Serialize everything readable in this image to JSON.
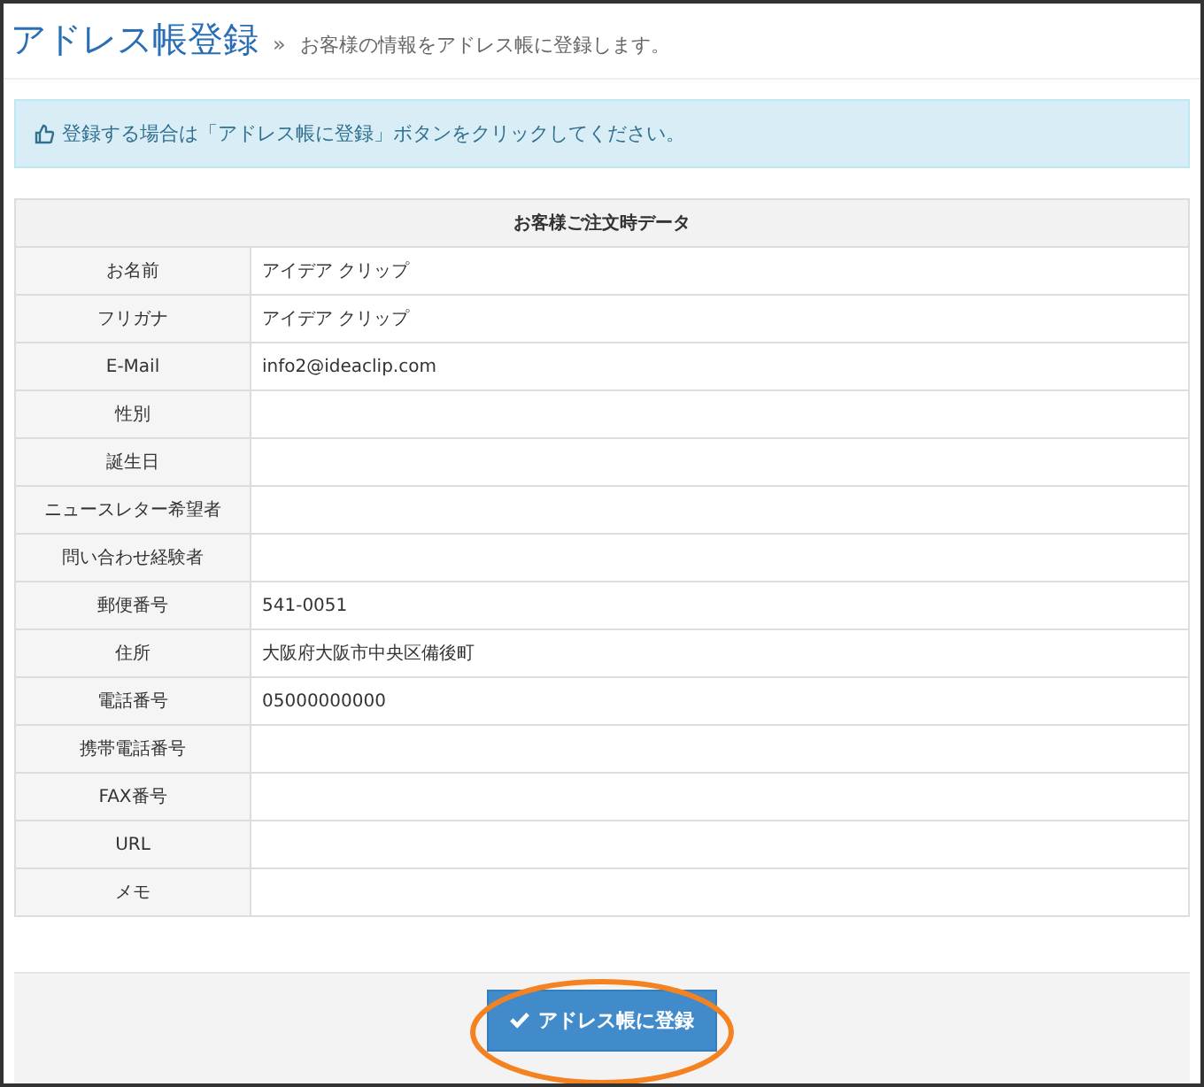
{
  "header": {
    "title": "アドレス帳登録",
    "separator": "»",
    "subtitle": "お客様の情報をアドレス帳に登録します。"
  },
  "notice": {
    "text": "登録する場合は「アドレス帳に登録」ボタンをクリックしてください。"
  },
  "table": {
    "caption": "お客様ご注文時データ",
    "rows": [
      {
        "label": "お名前",
        "value": "アイデア クリップ"
      },
      {
        "label": "フリガナ",
        "value": "アイデア クリップ"
      },
      {
        "label": "E-Mail",
        "value": "info2@ideaclip.com"
      },
      {
        "label": "性別"
      },
      {
        "label": "誕生日"
      },
      {
        "label": "ニュースレター希望者"
      },
      {
        "label": "問い合わせ経験者"
      },
      {
        "label": "郵便番号",
        "value": "541-0051"
      },
      {
        "label": "住所",
        "value": "大阪府大阪市中央区備後町"
      },
      {
        "label": "電話番号",
        "value": "05000000000"
      },
      {
        "label": "携帯電話番号"
      },
      {
        "label": "FAX番号"
      },
      {
        "label": "URL"
      },
      {
        "label": "メモ"
      }
    ]
  },
  "footer": {
    "button": {
      "label": "アドレス帳に登録",
      "highlighted": true
    }
  }
}
